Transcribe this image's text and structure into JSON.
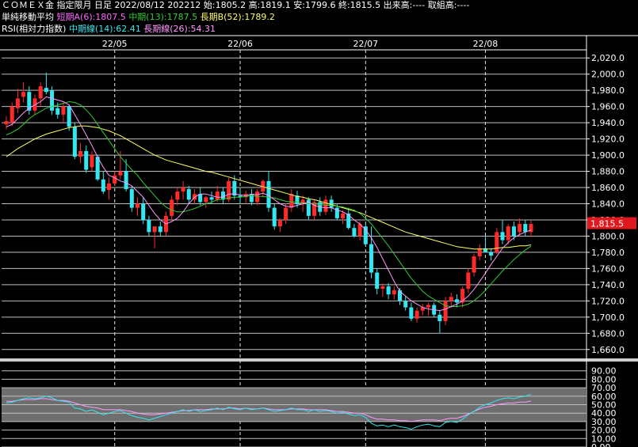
{
  "header": {
    "line1": "ＣＯＭＥＸ金 指定限月 日足 2022/08/12 202212 始:1805.2 高:1819.1 安:1799.6 終:1815.5 出来高:---- 取組高:----",
    "ma_title": "単純移動平均",
    "ma_short": "短期A(6):1807.5",
    "ma_mid": "中期(13):1787.5",
    "ma_long": "長期B(52):1789.2",
    "rsi_title": "RSI(相対力指数)",
    "rsi_mid": "中期線(14):62.41",
    "rsi_long": "長期線(26):54.31"
  },
  "colors": {
    "up": "#ff2a2a",
    "down": "#33e6f0",
    "ma6": "#ff99ff",
    "ma13": "#33cc33",
    "ma52": "#ffff66",
    "rsi14": "#33e6f0",
    "rsi26": "#ff99ff",
    "price_badge": "#e0191e",
    "header_short": "#ff66ff",
    "header_mid": "#33cc33",
    "header_long": "#ffff66"
  },
  "chart_data": [
    {
      "type": "candlestick",
      "title": "ＣＯＭＥＸ金 指定限月 日足",
      "x_ticks": [
        "22/05",
        "22/06",
        "22/07",
        "22/08"
      ],
      "x_tick_index": [
        19,
        41,
        63,
        84
      ],
      "y_ticks": [
        "1,660.0",
        "1,680.0",
        "1,700.0",
        "1,720.0",
        "1,740.0",
        "1,760.0",
        "1,780.0",
        "1,800.0",
        "1,820.0",
        "1,840.0",
        "1,860.0",
        "1,880.0",
        "1,900.0",
        "1,920.0",
        "1,940.0",
        "1,960.0",
        "1,980.0",
        "2,000.0",
        "2,020.0"
      ],
      "ylim": [
        1650,
        2030
      ],
      "last_price_label": "1,815.5",
      "last_price": 1815.5,
      "candles": [
        [
          1938,
          1948,
          1932,
          1942
        ],
        [
          1940,
          1965,
          1936,
          1960
        ],
        [
          1958,
          1982,
          1952,
          1970
        ],
        [
          1972,
          1990,
          1965,
          1978
        ],
        [
          1978,
          1985,
          1950,
          1955
        ],
        [
          1955,
          1975,
          1950,
          1970
        ],
        [
          1970,
          1990,
          1960,
          1985
        ],
        [
          1983,
          2002,
          1975,
          1978
        ],
        [
          1980,
          1985,
          1950,
          1955
        ],
        [
          1958,
          1965,
          1945,
          1950
        ],
        [
          1950,
          1965,
          1940,
          1960
        ],
        [
          1960,
          1962,
          1930,
          1935
        ],
        [
          1935,
          1940,
          1895,
          1898
        ],
        [
          1898,
          1915,
          1890,
          1905
        ],
        [
          1905,
          1912,
          1878,
          1882
        ],
        [
          1885,
          1905,
          1880,
          1900
        ],
        [
          1898,
          1900,
          1868,
          1870
        ],
        [
          1870,
          1880,
          1852,
          1855
        ],
        [
          1857,
          1872,
          1845,
          1865
        ],
        [
          1865,
          1880,
          1862,
          1875
        ],
        [
          1875,
          1905,
          1870,
          1880
        ],
        [
          1880,
          1895,
          1855,
          1858
        ],
        [
          1858,
          1862,
          1830,
          1835
        ],
        [
          1835,
          1848,
          1825,
          1840
        ],
        [
          1840,
          1848,
          1815,
          1820
        ],
        [
          1820,
          1825,
          1800,
          1805
        ],
        [
          1805,
          1812,
          1785,
          1812
        ],
        [
          1812,
          1818,
          1800,
          1805
        ],
        [
          1805,
          1830,
          1800,
          1825
        ],
        [
          1825,
          1850,
          1820,
          1845
        ],
        [
          1845,
          1860,
          1838,
          1855
        ],
        [
          1855,
          1868,
          1845,
          1860
        ],
        [
          1858,
          1862,
          1840,
          1845
        ],
        [
          1845,
          1858,
          1840,
          1852
        ],
        [
          1852,
          1860,
          1838,
          1842
        ],
        [
          1842,
          1850,
          1835,
          1848
        ],
        [
          1848,
          1855,
          1840,
          1845
        ],
        [
          1845,
          1862,
          1842,
          1855
        ],
        [
          1855,
          1860,
          1840,
          1845
        ],
        [
          1845,
          1872,
          1842,
          1868
        ],
        [
          1868,
          1875,
          1845,
          1850
        ],
        [
          1850,
          1858,
          1840,
          1848
        ],
        [
          1848,
          1856,
          1840,
          1852
        ],
        [
          1852,
          1858,
          1838,
          1842
        ],
        [
          1842,
          1858,
          1838,
          1855
        ],
        [
          1855,
          1870,
          1848,
          1868
        ],
        [
          1868,
          1880,
          1830,
          1835
        ],
        [
          1835,
          1840,
          1808,
          1812
        ],
        [
          1812,
          1822,
          1805,
          1820
        ],
        [
          1820,
          1840,
          1815,
          1835
        ],
        [
          1835,
          1858,
          1830,
          1852
        ],
        [
          1850,
          1856,
          1835,
          1840
        ],
        [
          1840,
          1850,
          1830,
          1845
        ],
        [
          1845,
          1848,
          1820,
          1825
        ],
        [
          1825,
          1845,
          1820,
          1842
        ],
        [
          1842,
          1848,
          1825,
          1830
        ],
        [
          1830,
          1850,
          1826,
          1845
        ],
        [
          1845,
          1850,
          1830,
          1835
        ],
        [
          1835,
          1840,
          1820,
          1822
        ],
        [
          1822,
          1832,
          1815,
          1828
        ],
        [
          1828,
          1835,
          1808,
          1810
        ],
        [
          1810,
          1815,
          1798,
          1800
        ],
        [
          1800,
          1818,
          1795,
          1815
        ],
        [
          1812,
          1815,
          1788,
          1790
        ],
        [
          1790,
          1812,
          1748,
          1755
        ],
        [
          1755,
          1760,
          1728,
          1735
        ],
        [
          1735,
          1742,
          1725,
          1738
        ],
        [
          1738,
          1742,
          1722,
          1728
        ],
        [
          1728,
          1738,
          1722,
          1733
        ],
        [
          1733,
          1736,
          1715,
          1720
        ],
        [
          1720,
          1726,
          1708,
          1712
        ],
        [
          1712,
          1718,
          1695,
          1698
        ],
        [
          1698,
          1712,
          1693,
          1708
        ],
        [
          1708,
          1716,
          1702,
          1712
        ],
        [
          1712,
          1718,
          1702,
          1715
        ],
        [
          1715,
          1718,
          1700,
          1703
        ],
        [
          1703,
          1708,
          1680,
          1695
        ],
        [
          1695,
          1725,
          1690,
          1720
        ],
        [
          1720,
          1730,
          1712,
          1725
        ],
        [
          1722,
          1728,
          1712,
          1718
        ],
        [
          1718,
          1738,
          1712,
          1735
        ],
        [
          1735,
          1760,
          1730,
          1755
        ],
        [
          1755,
          1778,
          1750,
          1775
        ],
        [
          1775,
          1790,
          1770,
          1785
        ],
        [
          1785,
          1800,
          1780,
          1780
        ],
        [
          1780,
          1785,
          1770,
          1776
        ],
        [
          1780,
          1810,
          1778,
          1805
        ],
        [
          1805,
          1820,
          1790,
          1795
        ],
        [
          1795,
          1815,
          1790,
          1812
        ],
        [
          1812,
          1818,
          1795,
          1800
        ],
        [
          1805,
          1822,
          1800,
          1815
        ],
        [
          1815,
          1820,
          1800,
          1805
        ],
        [
          1805,
          1819,
          1799,
          1815
        ]
      ],
      "ma6": [
        1935,
        1938,
        1945,
        1952,
        1958,
        1962,
        1966,
        1972,
        1970,
        1968,
        1966,
        1962,
        1950,
        1938,
        1925,
        1912,
        1898,
        1885,
        1875,
        1872,
        1868,
        1866,
        1862,
        1855,
        1848,
        1838,
        1828,
        1820,
        1815,
        1818,
        1822,
        1830,
        1840,
        1848,
        1852,
        1852,
        1850,
        1848,
        1848,
        1852,
        1852,
        1851,
        1850,
        1852,
        1851,
        1853,
        1850,
        1845,
        1840,
        1837,
        1836,
        1838,
        1840,
        1842,
        1838,
        1836,
        1835,
        1835,
        1832,
        1830,
        1826,
        1820,
        1815,
        1808,
        1798,
        1786,
        1772,
        1758,
        1744,
        1732,
        1726,
        1720,
        1716,
        1712,
        1710,
        1709,
        1708,
        1710,
        1713,
        1716,
        1720,
        1726,
        1734,
        1744,
        1754,
        1765,
        1775,
        1785,
        1792,
        1798,
        1802,
        1805,
        1807.5
      ],
      "ma13": [
        1925,
        1928,
        1932,
        1938,
        1945,
        1950,
        1954,
        1958,
        1960,
        1962,
        1964,
        1966,
        1965,
        1962,
        1956,
        1948,
        1938,
        1928,
        1918,
        1908,
        1898,
        1890,
        1882,
        1875,
        1866,
        1858,
        1850,
        1842,
        1836,
        1832,
        1830,
        1830,
        1832,
        1834,
        1837,
        1840,
        1842,
        1845,
        1846,
        1847,
        1848,
        1848,
        1849,
        1850,
        1849,
        1849,
        1848,
        1847,
        1845,
        1843,
        1842,
        1842,
        1841,
        1840,
        1840,
        1839,
        1838,
        1838,
        1837,
        1836,
        1834,
        1832,
        1828,
        1822,
        1815,
        1806,
        1797,
        1788,
        1778,
        1768,
        1758,
        1748,
        1740,
        1732,
        1726,
        1722,
        1718,
        1714,
        1713,
        1713,
        1714,
        1716,
        1720,
        1726,
        1733,
        1741,
        1749,
        1757,
        1764,
        1771,
        1777,
        1783,
        1787.5
      ],
      "ma52": [
        1898,
        1903,
        1908,
        1912,
        1916,
        1920,
        1923,
        1926,
        1928,
        1930,
        1932,
        1934,
        1935,
        1936,
        1936,
        1935,
        1934,
        1932,
        1930,
        1927,
        1924,
        1920,
        1916,
        1912,
        1908,
        1904,
        1900,
        1897,
        1894,
        1892,
        1890,
        1888,
        1886,
        1884,
        1882,
        1880,
        1879,
        1877,
        1875,
        1873,
        1871,
        1869,
        1867,
        1865,
        1863,
        1861,
        1859,
        1857,
        1855,
        1853,
        1851,
        1849,
        1848,
        1846,
        1845,
        1843,
        1841,
        1839,
        1837,
        1835,
        1833,
        1831,
        1829,
        1826,
        1823,
        1820,
        1817,
        1814,
        1811,
        1808,
        1805,
        1803,
        1801,
        1799,
        1797,
        1795,
        1793,
        1791,
        1789,
        1787,
        1786,
        1785,
        1784,
        1784,
        1784,
        1784,
        1785,
        1786,
        1786,
        1787,
        1788,
        1788,
        1789.2
      ]
    },
    {
      "type": "line",
      "title": "RSI(相対力指数)",
      "y_ticks": [
        "0.00",
        "10.00",
        "20.00",
        "30.00",
        "40.00",
        "50.00",
        "60.00",
        "70.00",
        "80.00",
        "90.00"
      ],
      "ylim": [
        0,
        100
      ],
      "shaded_band": [
        30,
        70
      ],
      "series": [
        {
          "name": "中期線(14)",
          "values": [
            52,
            53,
            55,
            57,
            58,
            57,
            58,
            60,
            58,
            55,
            54,
            53,
            46,
            45,
            42,
            44,
            41,
            38,
            40,
            42,
            43,
            40,
            37,
            35,
            34,
            32,
            34,
            36,
            38,
            40,
            42,
            44,
            42,
            44,
            42,
            43,
            44,
            46,
            44,
            47,
            45,
            44,
            46,
            44,
            45,
            46,
            44,
            42,
            43,
            44,
            46,
            44,
            44,
            42,
            44,
            42,
            43,
            42,
            40,
            41,
            39,
            37,
            38,
            35,
            28,
            25,
            26,
            24,
            26,
            24,
            23,
            21,
            24,
            26,
            27,
            25,
            24,
            29,
            30,
            29,
            33,
            38,
            42,
            47,
            50,
            52,
            55,
            57,
            58,
            57,
            59,
            60,
            62.41
          ]
        },
        {
          "name": "長期線(26)",
          "values": [
            54,
            54,
            55,
            56,
            56,
            56,
            57,
            57,
            56,
            55,
            55,
            54,
            52,
            50,
            48,
            47,
            46,
            44,
            44,
            44,
            44,
            43,
            42,
            40,
            39,
            38,
            38,
            39,
            40,
            41,
            42,
            43,
            43,
            44,
            44,
            44,
            45,
            45,
            45,
            46,
            46,
            45,
            46,
            45,
            45,
            46,
            45,
            44,
            44,
            44,
            45,
            45,
            45,
            44,
            44,
            44,
            44,
            43,
            42,
            42,
            41,
            40,
            40,
            38,
            35,
            33,
            33,
            32,
            32,
            31,
            31,
            30,
            31,
            32,
            32,
            32,
            31,
            33,
            34,
            34,
            36,
            39,
            42,
            45,
            47,
            48,
            50,
            51,
            52,
            52,
            53,
            53,
            54.31
          ]
        }
      ]
    }
  ]
}
